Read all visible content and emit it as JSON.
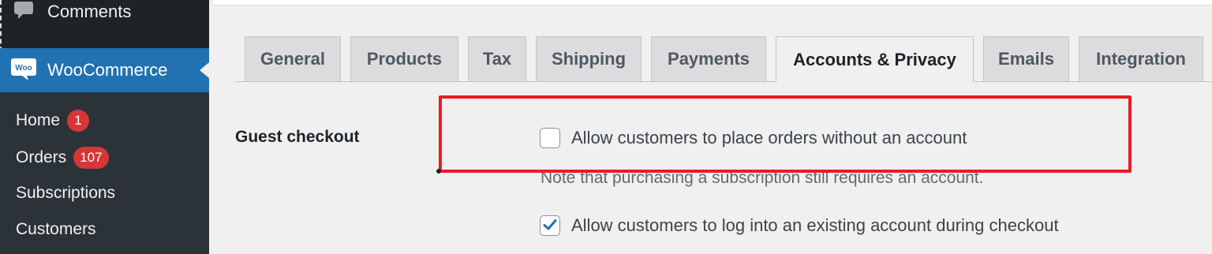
{
  "sidebar": {
    "comments_label": "Comments",
    "woo_label": "WooCommerce",
    "woo_logo_text": "Woo",
    "items": [
      {
        "label": "Home",
        "badge": "1"
      },
      {
        "label": "Orders",
        "badge": "107"
      },
      {
        "label": "Subscriptions"
      },
      {
        "label": "Customers"
      }
    ]
  },
  "tabs": [
    "General",
    "Products",
    "Tax",
    "Shipping",
    "Payments",
    "Accounts & Privacy",
    "Emails",
    "Integration"
  ],
  "active_tab": "Accounts & Privacy",
  "settings": {
    "guest_checkout_label": "Guest checkout",
    "option_place_orders": {
      "label": "Allow customers to place orders without an account",
      "checked": false
    },
    "note": "Note that purchasing a subscription still requires an account.",
    "option_login": {
      "label": "Allow customers to log into an existing account during checkout",
      "checked": true
    }
  },
  "colors": {
    "accent": "#2271b1",
    "badge": "#d63638",
    "highlight": "#ec1c24"
  },
  "icons": [
    "comment-icon",
    "woo-logo-icon",
    "checkmark-icon"
  ]
}
